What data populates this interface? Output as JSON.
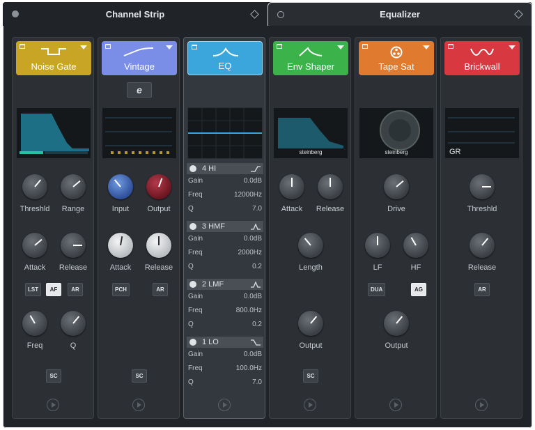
{
  "tabs": {
    "channel_strip": "Channel Strip",
    "equalizer": "Equalizer"
  },
  "colors": {
    "noise_gate": "#c9a526",
    "vintage": "#7a8ee8",
    "eq": "#3aa6dc",
    "env_shaper": "#3cb24a",
    "tape_sat": "#e07a2e",
    "brickwall": "#d8383f"
  },
  "modules": [
    {
      "name": "Noise Gate",
      "knobs": [
        "Threshld",
        "Range",
        "Attack",
        "Release",
        "Freq",
        "Q"
      ],
      "buttons": [
        "LST",
        "AF",
        "AR",
        "SC"
      ]
    },
    {
      "name": "Vintage",
      "mode_button": "e",
      "knobs": [
        "Input",
        "Output",
        "Attack",
        "Release"
      ],
      "buttons": [
        "PCH",
        "AR",
        "SC"
      ]
    },
    {
      "name": "EQ",
      "bands": [
        {
          "name": "4 HI",
          "gain": "0.0dB",
          "freq": "12000Hz",
          "q": "7.0"
        },
        {
          "name": "3 HMF",
          "gain": "0.0dB",
          "freq": "2000Hz",
          "q": "0.2"
        },
        {
          "name": "2 LMF",
          "gain": "0.0dB",
          "freq": "800.0Hz",
          "q": "0.2"
        },
        {
          "name": "1 LO",
          "gain": "0.0dB",
          "freq": "100.0Hz",
          "q": "7.0"
        }
      ],
      "row_labels": {
        "gain": "Gain",
        "freq": "Freq",
        "q": "Q"
      }
    },
    {
      "name": "Env Shaper",
      "knobs": [
        "Attack",
        "Release",
        "Length",
        "Output"
      ],
      "buttons": [
        "SC"
      ],
      "brand": "steinberg"
    },
    {
      "name": "Tape Sat",
      "knobs": [
        "Drive",
        "LF",
        "HF",
        "Output"
      ],
      "buttons": [
        "DUA",
        "AG"
      ],
      "brand": "steinberg"
    },
    {
      "name": "Brickwall",
      "display_label": "GR",
      "knobs": [
        "Threshld",
        "Release"
      ],
      "buttons": [
        "AR"
      ]
    }
  ],
  "icons": {
    "power": "power-icon",
    "menu": "dropdown-triangle-icon",
    "footer": "play-circle-icon",
    "settings": "diamond-icon"
  }
}
